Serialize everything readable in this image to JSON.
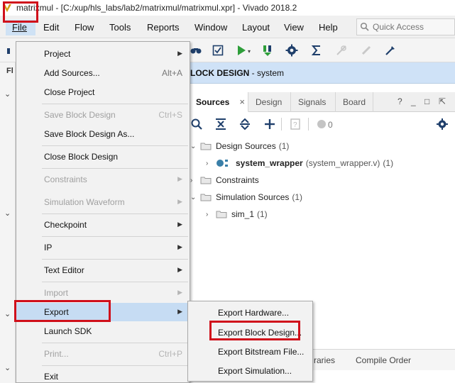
{
  "window": {
    "title": "matrixmul - [C:/xup/hls_labs/lab2/matrixmul/matrixmul.xpr] - Vivado 2018.2"
  },
  "menubar": {
    "items": [
      {
        "label": "File"
      },
      {
        "label": "Edit"
      },
      {
        "label": "Flow"
      },
      {
        "label": "Tools"
      },
      {
        "label": "Reports"
      },
      {
        "label": "Window"
      },
      {
        "label": "Layout"
      },
      {
        "label": "View"
      },
      {
        "label": "Help"
      }
    ],
    "quick_access_placeholder": "Quick Access"
  },
  "block_design_header": {
    "label_bold": "LOCK DESIGN",
    "label_rest": " - system"
  },
  "sources_panel": {
    "tabs": [
      {
        "label": "Sources",
        "active": true
      },
      {
        "label": "Design"
      },
      {
        "label": "Signals"
      },
      {
        "label": "Board"
      }
    ],
    "panel_controls": [
      "?",
      "_",
      "□",
      "⇱"
    ],
    "status_count": "0",
    "tree": [
      {
        "label": "Design Sources",
        "count": "(1)"
      },
      {
        "label": "system_wrapper",
        "file": "(system_wrapper.v)",
        "count": "(1)"
      },
      {
        "label": "Constraints"
      },
      {
        "label": "Simulation Sources",
        "count": "(1)"
      },
      {
        "label": "sim_1",
        "count": "(1)"
      }
    ],
    "bottom_tabs": [
      "raries",
      "Compile Order"
    ]
  },
  "file_menu": {
    "items": [
      {
        "label": "Project",
        "submenu": true
      },
      {
        "label": "Add Sources...",
        "accel": "Alt+A"
      },
      {
        "label": "Close Project"
      },
      {
        "label": "Save Block Design",
        "accel": "Ctrl+S",
        "disabled": true
      },
      {
        "label": "Save Block Design As..."
      },
      {
        "label": "Close Block Design"
      },
      {
        "label": "Constraints",
        "submenu": true,
        "disabled": true
      },
      {
        "label": "Simulation Waveform",
        "submenu": true,
        "disabled": true
      },
      {
        "label": "Checkpoint",
        "submenu": true
      },
      {
        "label": "IP",
        "submenu": true
      },
      {
        "label": "Text Editor",
        "submenu": true
      },
      {
        "label": "Import",
        "submenu": true,
        "disabled": true
      },
      {
        "label": "Export",
        "submenu": true,
        "highlighted": true
      },
      {
        "label": "Launch SDK"
      },
      {
        "label": "Print...",
        "accel": "Ctrl+P",
        "disabled": true
      },
      {
        "label": "Exit"
      }
    ]
  },
  "export_menu": {
    "items": [
      {
        "label": "Export Hardware..."
      },
      {
        "label": "Export Block Design..."
      },
      {
        "label": "Export Bitstream File..."
      },
      {
        "label": "Export Simulation..."
      }
    ]
  },
  "colors": {
    "highlight_box": "#d0101b",
    "menu_highlight": "#c6dcf3",
    "header_blue": "#cfe2f7",
    "run_green": "#2e9e3a"
  }
}
